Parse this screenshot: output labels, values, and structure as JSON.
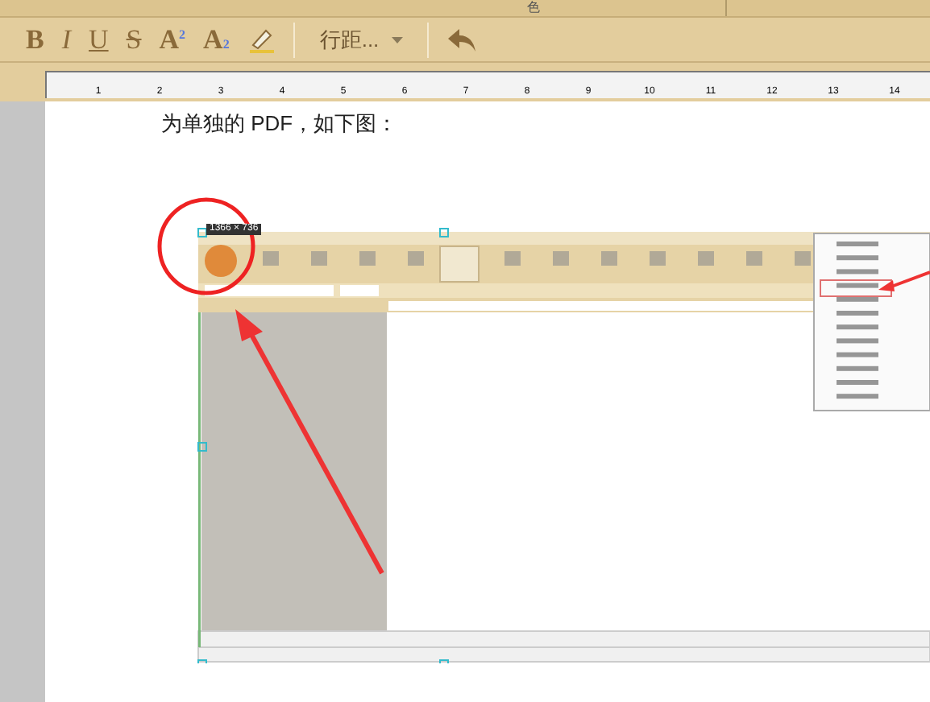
{
  "top_bar": {
    "label": "色"
  },
  "format_toolbar": {
    "buttons": [
      {
        "kind": "bold",
        "label": "B"
      },
      {
        "kind": "italic",
        "label": "I"
      },
      {
        "kind": "underline",
        "label": "U"
      },
      {
        "kind": "strike",
        "label": "S"
      },
      {
        "kind": "superscript",
        "label": "A",
        "index": "2"
      },
      {
        "kind": "subscript",
        "label": "A",
        "index": "2"
      }
    ],
    "line_spacing": "行距..."
  },
  "ruler": {
    "ticks": [
      "1",
      "2",
      "3",
      "4",
      "5",
      "6",
      "7",
      "8",
      "9",
      "10",
      "11",
      "12",
      "13",
      "14"
    ]
  },
  "document": {
    "paragraph": "为单独的 PDF，如下图：",
    "image": {
      "size_label": "1366 × 736"
    }
  }
}
